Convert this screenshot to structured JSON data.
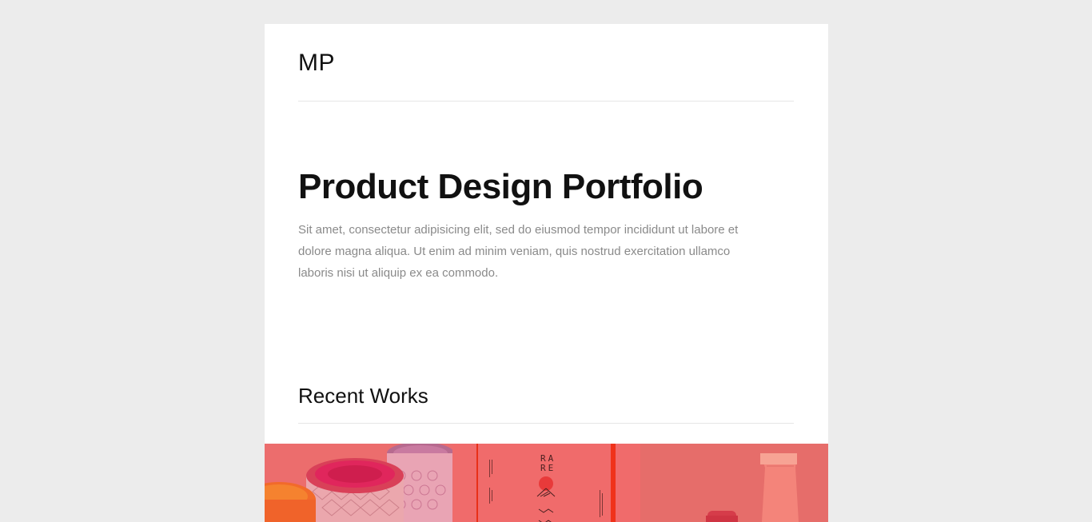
{
  "header": {
    "logo": "MP"
  },
  "hero": {
    "title": "Product Design Portfolio",
    "text": "Sit amet, consectetur adipisicing elit, sed do eiusmod tempor incididunt ut labore et dolore magna aliqua. Ut enim ad minim veniam, quis nostrud exercitation ullamco laboris nisi ut aliquip ex ea commodo."
  },
  "recent_works": {
    "title": "Recent Works",
    "items": [
      {
        "name": "work-packaging-cans",
        "overlay_color": "#ec6d6d"
      },
      {
        "name": "work-rare-poster",
        "overlay_color": "#f06b6b",
        "text_a": "RA",
        "text_b": "RE"
      },
      {
        "name": "work-bottle-packaging",
        "overlay_color": "#e66d6a"
      }
    ]
  },
  "colors": {
    "background": "#ececec",
    "card": "#ffffff",
    "accent_overlay": "#ec6d6d"
  }
}
